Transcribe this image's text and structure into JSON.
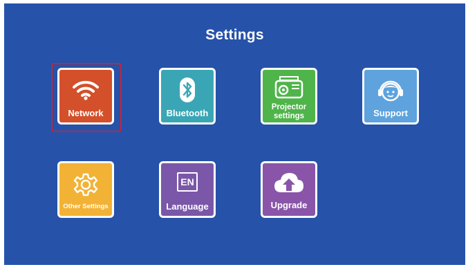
{
  "page": {
    "title": "Settings"
  },
  "tiles": {
    "network": {
      "label": "Network",
      "icon": "wifi-icon",
      "color": "#d3502a",
      "selected": true
    },
    "bluetooth": {
      "label": "Bluetooth",
      "icon": "bluetooth-icon",
      "color": "#3aa6b5"
    },
    "projector": {
      "label_line1": "Projector",
      "label_line2": "settings",
      "icon": "projector-icon",
      "color": "#4fb44a"
    },
    "support": {
      "label": "Support",
      "icon": "headset-icon",
      "color": "#5ea3dd"
    },
    "other": {
      "label": "Other Settings",
      "icon": "gear-icon",
      "color": "#f2b235"
    },
    "language": {
      "label": "Language",
      "icon": "language-en-icon",
      "icon_text": "EN",
      "color": "#7a57a8"
    },
    "upgrade": {
      "label": "Upgrade",
      "icon": "cloud-upload-icon",
      "color": "#8a55a9"
    }
  },
  "colors": {
    "background": "#2652a9",
    "focus": "#d0212c"
  }
}
